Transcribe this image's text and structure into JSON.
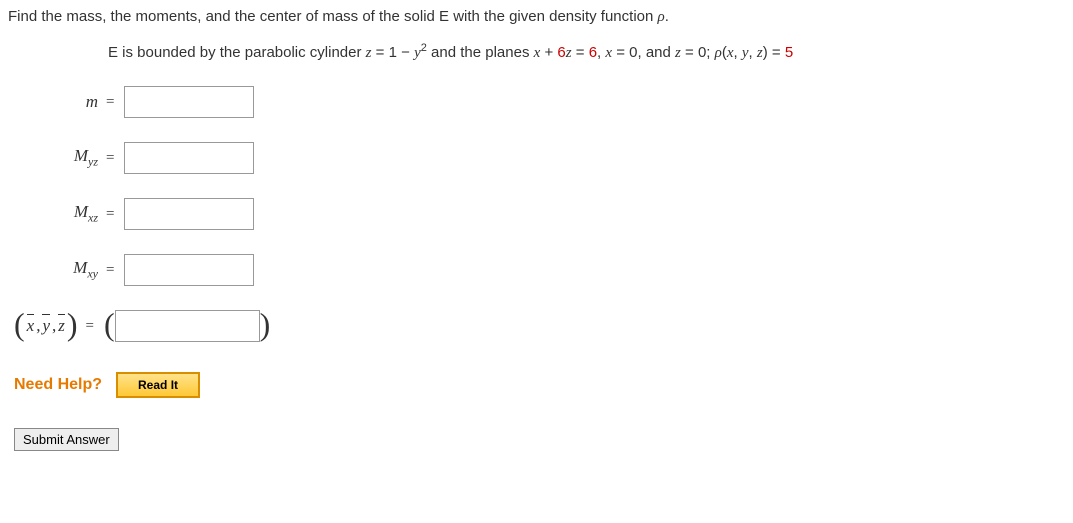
{
  "question_intro": "Find the mass, the moments, and the center of mass of the solid E with the given density function ",
  "rho": "ρ",
  "period": ".",
  "sub_line": {
    "p1": "E is bounded by the parabolic cylinder ",
    "eq1_l": "z",
    "eq1_m": " = 1 − ",
    "eq1_r": "y",
    "sq": "2",
    "p2": " and the planes ",
    "eq2_l": "x",
    "eq2_m": " + ",
    "eq2_c": "6",
    "eq2_z": "z",
    "eq2_r": " = ",
    "eq2_v": "6",
    "p3": ", ",
    "eq3_l": "x",
    "eq3_m": " = 0, and ",
    "eq4_l": "z",
    "eq4_m": " = 0; ",
    "rho_eq_l": "ρ",
    "rho_eq_p": "(",
    "rho_x": "x",
    "rho_c1": ", ",
    "rho_y": "y",
    "rho_c2": ", ",
    "rho_z": "z",
    "rho_eq_pc": ")",
    "rho_eq_m": " = ",
    "rho_eq_v": "5"
  },
  "labels": {
    "m": "m",
    "myz_m": "M",
    "myz_s": "yz",
    "mxz_m": "M",
    "mxz_s": "xz",
    "mxy_m": "M",
    "mxy_s": "xy"
  },
  "eq_sign": "=",
  "center_mass": {
    "x": "x",
    "y": "y",
    "z": "z",
    "c": ", "
  },
  "need_help_label": "Need Help?",
  "read_it_label": "Read It",
  "submit_label": "Submit Answer"
}
